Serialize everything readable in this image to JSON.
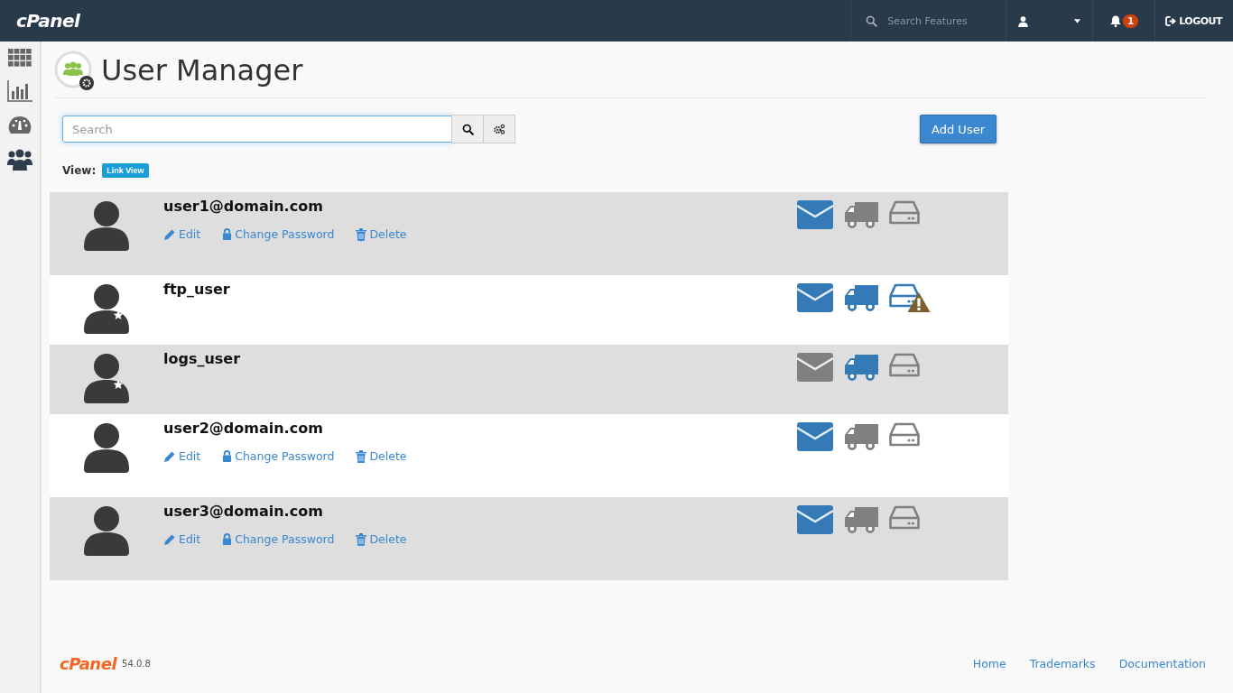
{
  "topbar": {
    "logo": "cPanel",
    "search": {
      "placeholder": "Search Features"
    },
    "notifications": {
      "count": "1"
    },
    "logout": "LOGOUT"
  },
  "page": {
    "title": "User Manager",
    "search": {
      "placeholder": "Search"
    },
    "add_button": "Add User",
    "view_label": "View:",
    "view_mode": "Link View"
  },
  "users": [
    {
      "name": "user1@domain.com",
      "kind": "subaccount",
      "actions": [
        {
          "kind": "edit",
          "label": "Edit"
        },
        {
          "kind": "password",
          "label": "Change Password"
        },
        {
          "kind": "delete",
          "label": "Delete"
        }
      ],
      "services": [
        {
          "kind": "email",
          "enabled": true,
          "warning": false
        },
        {
          "kind": "ftp",
          "enabled": false,
          "warning": false
        },
        {
          "kind": "webdisk",
          "enabled": false,
          "warning": false
        }
      ]
    },
    {
      "name": "ftp_user",
      "kind": "service",
      "services": [
        {
          "kind": "email",
          "enabled": true,
          "warning": false
        },
        {
          "kind": "ftp",
          "enabled": true,
          "warning": false
        },
        {
          "kind": "webdisk",
          "enabled": true,
          "warning": true
        }
      ]
    },
    {
      "name": "logs_user",
      "kind": "service",
      "services": [
        {
          "kind": "email",
          "enabled": false,
          "warning": false
        },
        {
          "kind": "ftp",
          "enabled": true,
          "warning": false
        },
        {
          "kind": "webdisk",
          "enabled": false,
          "warning": false
        }
      ]
    },
    {
      "name": "user2@domain.com",
      "kind": "subaccount",
      "actions": [
        {
          "kind": "edit",
          "label": "Edit"
        },
        {
          "kind": "password",
          "label": "Change Password"
        },
        {
          "kind": "delete",
          "label": "Delete"
        }
      ],
      "services": [
        {
          "kind": "email",
          "enabled": true,
          "warning": false
        },
        {
          "kind": "ftp",
          "enabled": false,
          "warning": false
        },
        {
          "kind": "webdisk",
          "enabled": false,
          "warning": false
        }
      ]
    },
    {
      "name": "user3@domain.com",
      "kind": "subaccount",
      "actions": [
        {
          "kind": "edit",
          "label": "Edit"
        },
        {
          "kind": "password",
          "label": "Change Password"
        },
        {
          "kind": "delete",
          "label": "Delete"
        }
      ],
      "services": [
        {
          "kind": "email",
          "enabled": true,
          "warning": false
        },
        {
          "kind": "ftp",
          "enabled": false,
          "warning": false
        },
        {
          "kind": "webdisk",
          "enabled": false,
          "warning": false
        }
      ]
    }
  ],
  "footer": {
    "logo": "cPanel",
    "version": "54.0.8",
    "links": [
      "Home",
      "Trademarks",
      "Documentation"
    ]
  }
}
